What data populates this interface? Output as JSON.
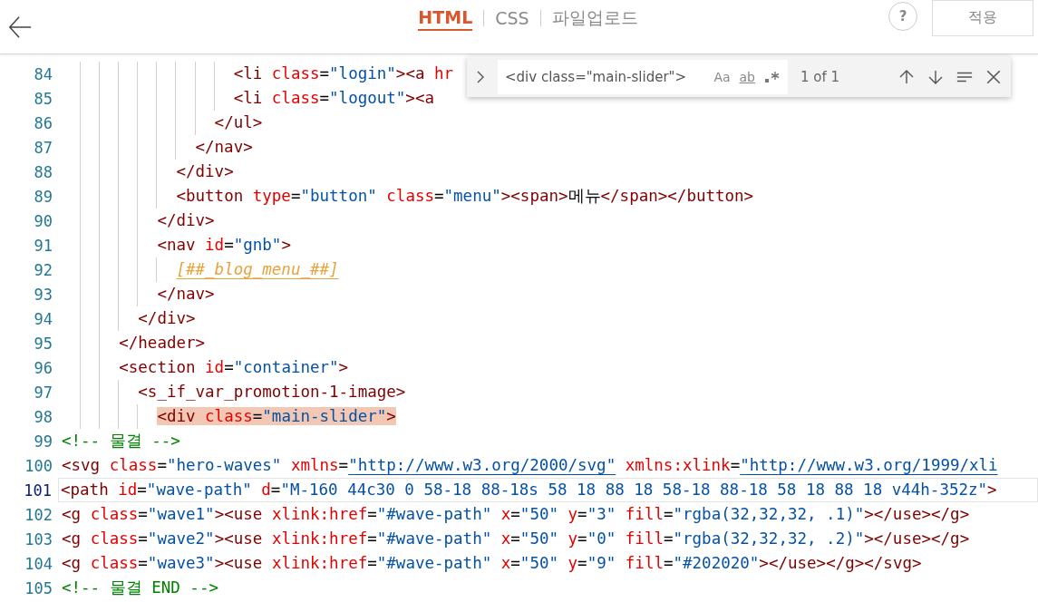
{
  "header": {
    "tabs": [
      {
        "label": "HTML",
        "selected": true
      },
      {
        "label": "CSS",
        "selected": false
      },
      {
        "label": "파일업로드",
        "selected": false
      }
    ],
    "help": "?",
    "apply_button": "적용"
  },
  "find": {
    "value": "<div class=\"main-slider\">",
    "options": [
      "Aa",
      "ab"
    ],
    "count": "1 of 1"
  },
  "lines": [
    {
      "number": "84",
      "kind": "code",
      "text": "                  <li class=\"login\"><a hr",
      "current": false,
      "highlighted": false
    },
    {
      "number": "85",
      "kind": "code",
      "text": "                  <li class=\"logout\"><a",
      "current": false,
      "highlighted": false
    },
    {
      "number": "86",
      "kind": "code",
      "text": "                </ul>",
      "current": false,
      "highlighted": false
    },
    {
      "number": "87",
      "kind": "code",
      "text": "              </nav>",
      "current": false,
      "highlighted": false
    },
    {
      "number": "88",
      "kind": "code",
      "text": "            </div>",
      "current": false,
      "highlighted": false
    },
    {
      "number": "89",
      "kind": "code",
      "text": "            <button type=\"button\" class=\"menu\"><span>메뉴</span></button>",
      "current": false,
      "highlighted": false
    },
    {
      "number": "90",
      "kind": "code",
      "text": "          </div>",
      "current": false,
      "highlighted": false
    },
    {
      "number": "91",
      "kind": "code",
      "text": "          <nav id=\"gnb\">",
      "current": false,
      "highlighted": false
    },
    {
      "number": "92",
      "kind": "template",
      "text": "            [##_blog_menu_##]",
      "current": false,
      "highlighted": false
    },
    {
      "number": "93",
      "kind": "code",
      "text": "          </nav>",
      "current": false,
      "highlighted": false
    },
    {
      "number": "94",
      "kind": "code",
      "text": "        </div>",
      "current": false,
      "highlighted": false
    },
    {
      "number": "95",
      "kind": "code",
      "text": "      </header>",
      "current": false,
      "highlighted": false
    },
    {
      "number": "96",
      "kind": "code",
      "text": "      <section id=\"container\">",
      "current": false,
      "highlighted": false
    },
    {
      "number": "97",
      "kind": "code",
      "text": "        <s_if_var_promotion-1-image>",
      "current": false,
      "highlighted": false
    },
    {
      "number": "98",
      "kind": "code",
      "text": "          <div class=\"main-slider\">",
      "current": false,
      "highlighted": true
    },
    {
      "number": "99",
      "kind": "comment",
      "text": "<!-- 물결 -->",
      "current": false,
      "highlighted": false
    },
    {
      "number": "100",
      "kind": "code",
      "text": "<svg class=\"hero-waves\" xmlns=\"http://www.w3.org/2000/svg\" xmlns:xlink=\"http://www.w3.org/1999/xli",
      "current": false,
      "highlighted": false
    },
    {
      "number": "101",
      "kind": "code",
      "text": "<path id=\"wave-path\" d=\"M-160 44c30 0 58-18 88-18s 58 18 88 18 58-18 88-18 58 18 88 18 v44h-352z\">",
      "current": true,
      "highlighted": false
    },
    {
      "number": "102",
      "kind": "code",
      "text": "<g class=\"wave1\"><use xlink:href=\"#wave-path\" x=\"50\" y=\"3\" fill=\"rgba(32,32,32, .1)\"></use></g>",
      "current": false,
      "highlighted": false
    },
    {
      "number": "103",
      "kind": "code",
      "text": "<g class=\"wave2\"><use xlink:href=\"#wave-path\" x=\"50\" y=\"0\" fill=\"rgba(32,32,32, .2)\"></use></g>",
      "current": false,
      "highlighted": false
    },
    {
      "number": "104",
      "kind": "code",
      "text": "<g class=\"wave3\"><use xlink:href=\"#wave-path\" x=\"50\" y=\"9\" fill=\"#202020\"></use></g></svg>",
      "current": false,
      "highlighted": false
    },
    {
      "number": "105",
      "kind": "comment",
      "text": "<!-- 물결 END -->",
      "current": false,
      "highlighted": false
    }
  ]
}
